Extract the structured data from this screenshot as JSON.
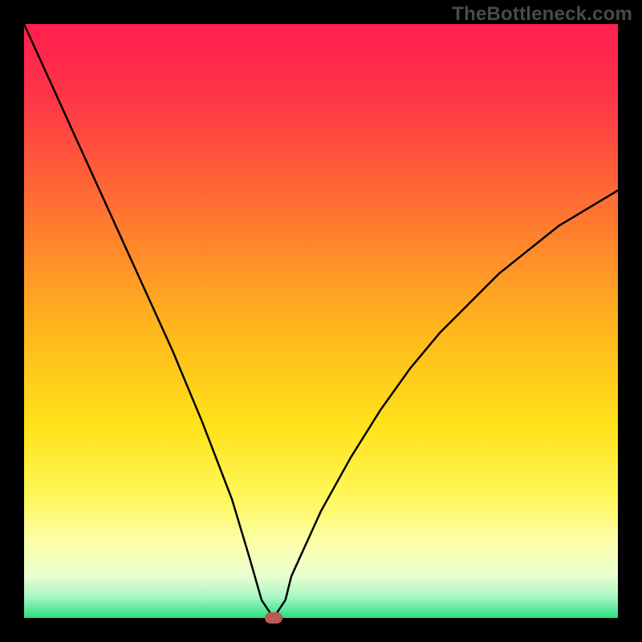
{
  "watermark": "TheBottleneck.com",
  "colors": {
    "frame_background": "#000000",
    "gradient_stops": [
      {
        "offset": 0.0,
        "color": "#ff1f4f"
      },
      {
        "offset": 0.12,
        "color": "#ff3448"
      },
      {
        "offset": 0.3,
        "color": "#ff6e33"
      },
      {
        "offset": 0.5,
        "color": "#ffb21e"
      },
      {
        "offset": 0.68,
        "color": "#ffe31a"
      },
      {
        "offset": 0.8,
        "color": "#fff85e"
      },
      {
        "offset": 0.88,
        "color": "#fbffb0"
      },
      {
        "offset": 0.93,
        "color": "#e8ffd0"
      },
      {
        "offset": 0.965,
        "color": "#a8f5c4"
      },
      {
        "offset": 1.0,
        "color": "#28e07d"
      }
    ],
    "curve_stroke": "#000000",
    "marker_fill": "#bb5a55"
  },
  "chart_data": {
    "type": "line",
    "title": "",
    "xlabel": "",
    "ylabel": "",
    "xlim": [
      0,
      100
    ],
    "ylim": [
      0,
      100
    ],
    "grid": false,
    "legend": false,
    "series": [
      {
        "name": "bottleneck-curve",
        "x": [
          0,
          5,
          10,
          15,
          20,
          25,
          30,
          35,
          38,
          40,
          42,
          44,
          45,
          50,
          55,
          60,
          65,
          70,
          75,
          80,
          85,
          90,
          95,
          100
        ],
        "y": [
          100,
          89,
          78,
          67,
          56,
          45,
          33,
          20,
          10,
          3,
          0,
          3,
          7,
          18,
          27,
          35,
          42,
          48,
          53,
          58,
          62,
          66,
          69,
          72
        ]
      }
    ],
    "annotations": [
      {
        "name": "optimal-marker",
        "x": 42,
        "y": 0
      }
    ]
  }
}
